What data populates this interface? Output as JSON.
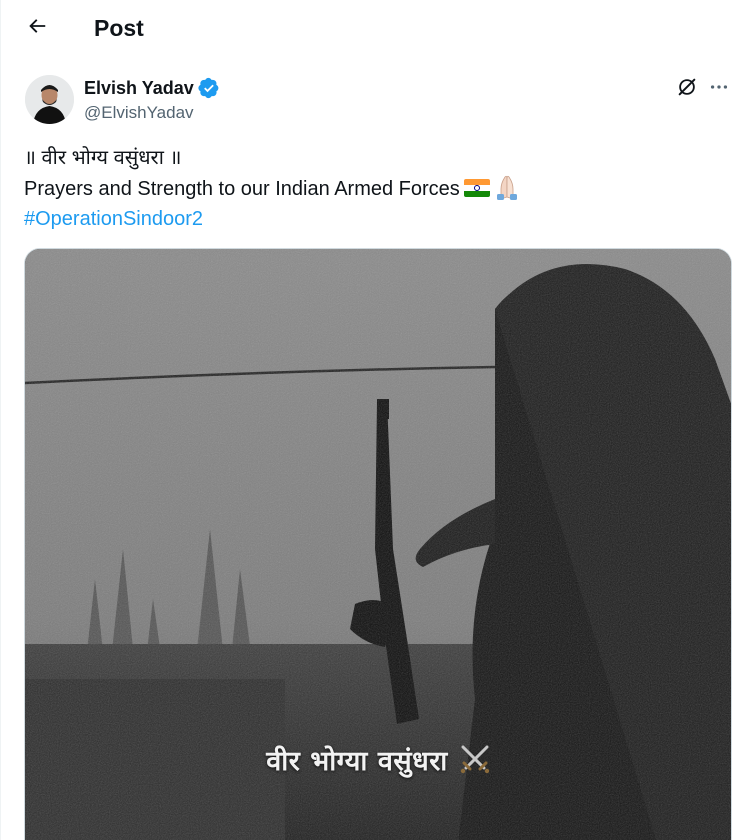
{
  "header": {
    "title": "Post",
    "back_icon": "arrow-left-icon"
  },
  "author": {
    "name": "Elvish Yadav",
    "handle": "@ElvishYadav",
    "verified_icon": "verified-badge-icon",
    "verified_color": "#1d9bf0"
  },
  "actions": {
    "grok_icon": "grok-icon",
    "more_icon": "more-horizontal-icon"
  },
  "tweet": {
    "line1": "॥ वीर भोग्य वसुंधरा ॥",
    "line2": "Prayers and Strength to our Indian Armed Forces",
    "line2_emojis": [
      "indian-flag-icon",
      "folded-hands-icon"
    ],
    "hashtag": "#OperationSindoor2",
    "hashtag_color": "#1d9bf0"
  },
  "media": {
    "caption": "वीर भोग्या वसुंधरा",
    "caption_emoji": "crossed-swords-icon"
  },
  "colors": {
    "text": "#0f1419",
    "secondary_text": "#536471",
    "accent": "#1d9bf0"
  }
}
